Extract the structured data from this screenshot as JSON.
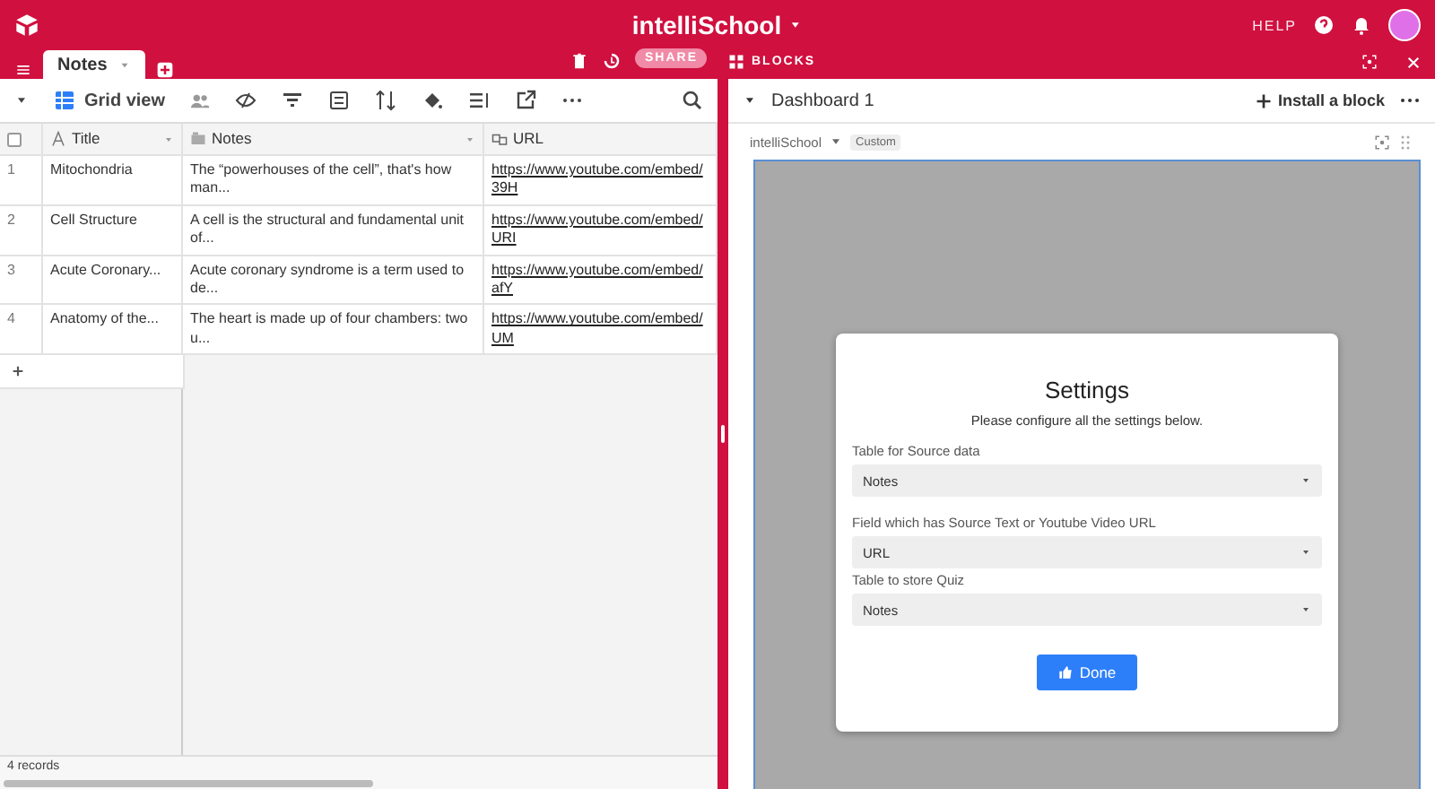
{
  "app_title": "intelliSchool",
  "header": {
    "help": "HELP"
  },
  "tabs": [
    {
      "label": "Notes",
      "selected": true
    }
  ],
  "share": "SHARE",
  "blocks": "BLOCKS",
  "view": {
    "name": "Grid view"
  },
  "table": {
    "select_all": {
      "checked": false
    },
    "columns": [
      "Title",
      "Notes",
      "URL"
    ],
    "rows": [
      {
        "number": "1",
        "title": "Mitochondria",
        "notes": "The “powerhouses of the cell”, that's how man...",
        "url": "https://www.youtube.com/embed/39H"
      },
      {
        "number": "2",
        "title": "Cell Structure",
        "notes": "A cell is the structural and fundamental unit of...",
        "url": "https://www.youtube.com/embed/URI"
      },
      {
        "number": "3",
        "title": "Acute Coronary...",
        "notes": "Acute coronary syndrome is a term used to de...",
        "url": "https://www.youtube.com/embed/afY"
      },
      {
        "number": "4",
        "title": "Anatomy of the...",
        "notes": "The heart is made up of four chambers: two u...",
        "url": "https://www.youtube.com/embed/UM"
      }
    ]
  },
  "status_bar": "4 records",
  "dashboard": {
    "title": "Dashboard 1",
    "install": "Install a block",
    "block_name": "intelliSchool",
    "block_tag": "Custom"
  },
  "settings": {
    "title": "Settings",
    "subtitle": "Please configure all the settings below.",
    "fields": [
      {
        "label": "Table for Source data",
        "value": "Notes"
      },
      {
        "label": "Field which has Source Text or Youtube Video URL",
        "value": "URL"
      },
      {
        "label": "Table to store Quiz",
        "value": "Notes"
      }
    ],
    "done": "Done"
  }
}
